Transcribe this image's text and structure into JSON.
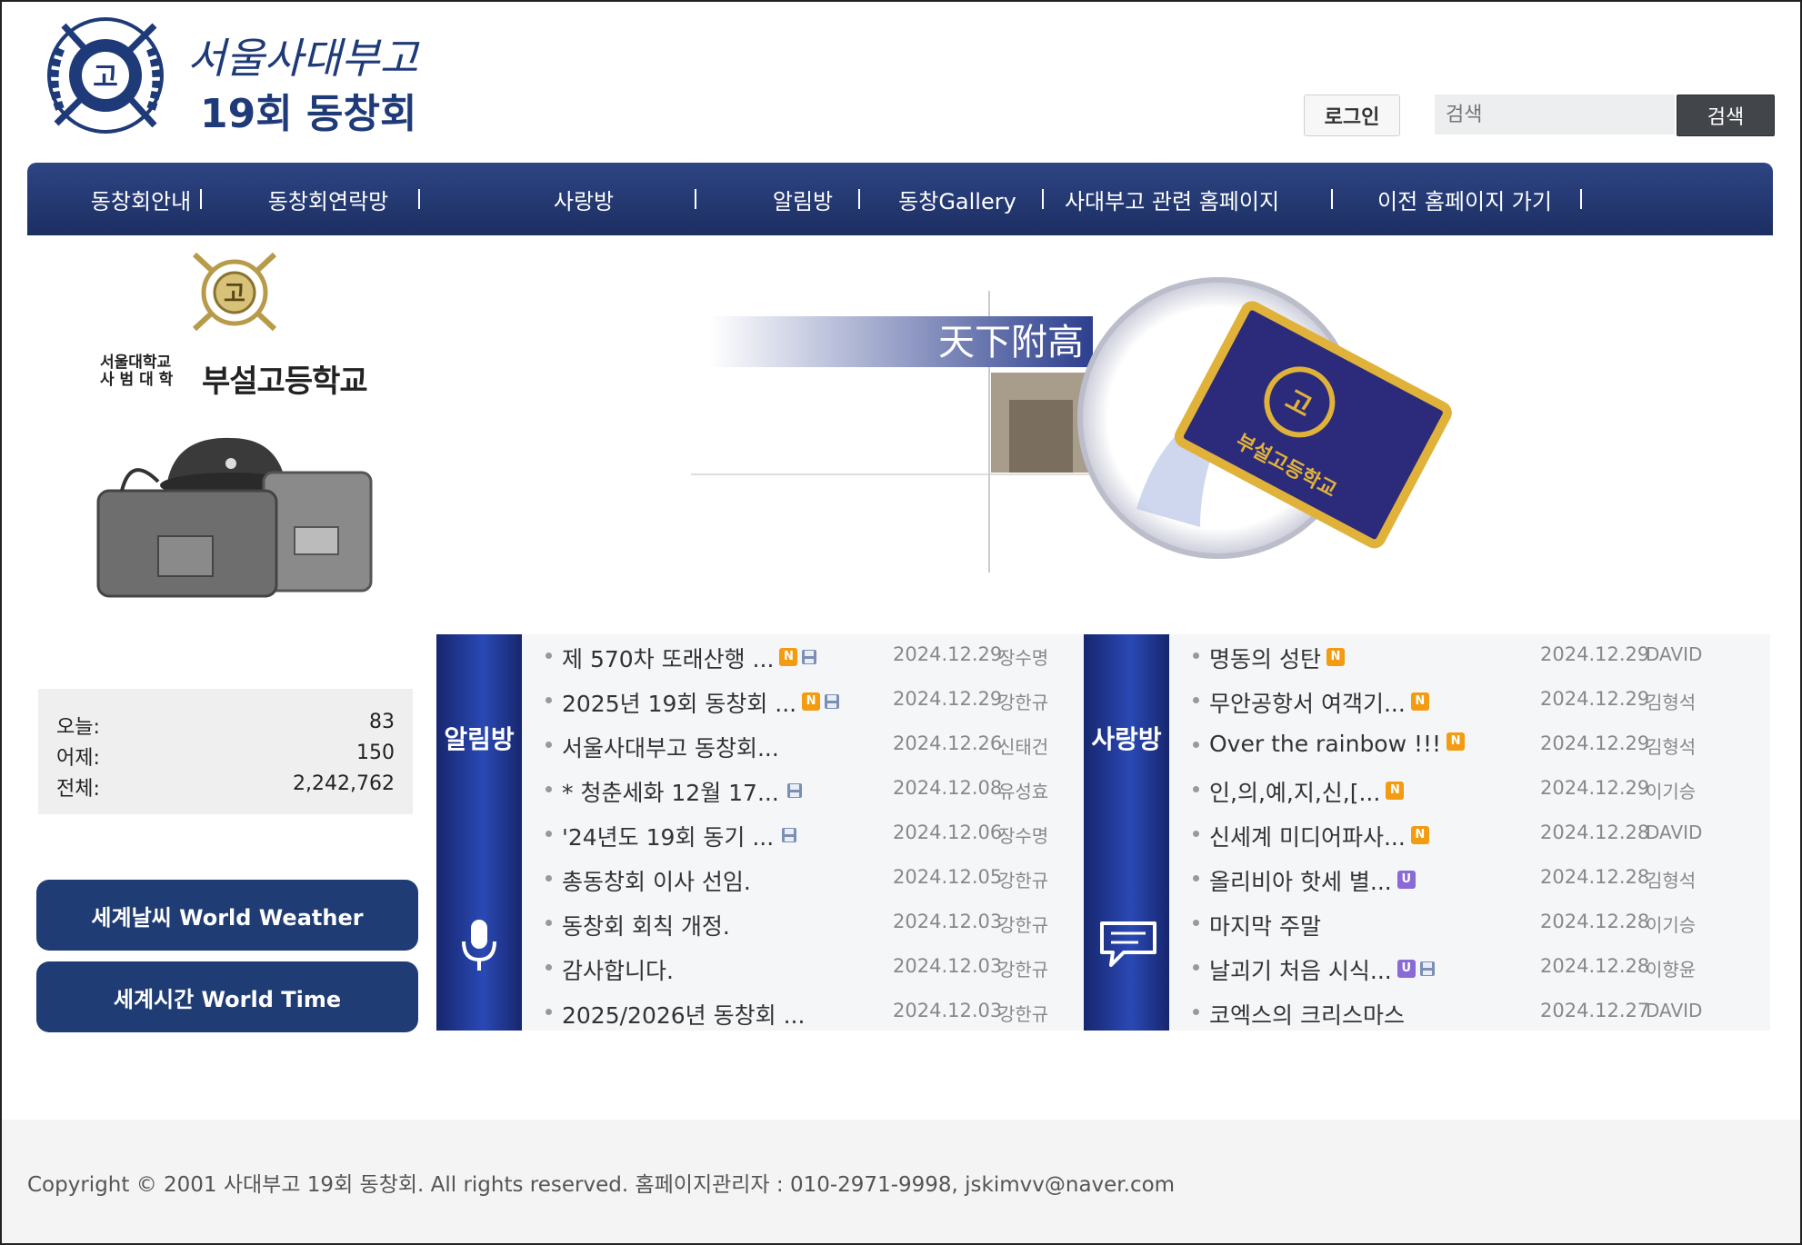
{
  "header": {
    "logo_line1": "서울사대부고",
    "logo_line2": "19회 동창회",
    "logo_emblem_char": "고",
    "login_label": "로그인",
    "search_placeholder": "검색",
    "search_button": "검색"
  },
  "nav": {
    "items": [
      {
        "label": "동창회안내"
      },
      {
        "label": "동창회연락망"
      },
      {
        "label": "사랑방"
      },
      {
        "label": "알림방"
      },
      {
        "label": "동창Gallery"
      },
      {
        "label": "사대부고 관련 홈페이지"
      },
      {
        "label": "이전 홈페이지 가기"
      }
    ]
  },
  "school": {
    "name_small_line1": "서울대학교",
    "name_small_line2": "사 범 대 학",
    "name_big": "부설고등학교",
    "emblem_char": "고"
  },
  "banner": {
    "motto": "天下附高",
    "flag_char": "고",
    "flag_text": "부설고등학교"
  },
  "stats": {
    "today_label": "오늘:",
    "today_value": "83",
    "yesterday_label": "어제:",
    "yesterday_value": "150",
    "total_label": "전체:",
    "total_value": "2,242,762"
  },
  "buttons": {
    "weather": "세계날씨 World Weather",
    "time": "세계시간 World Time"
  },
  "notice_board": {
    "title": "알림방",
    "icon": "microphone-icon",
    "posts": [
      {
        "title": "제 570차 또래산행 ...",
        "new": true,
        "file": true,
        "date": "2024.12.29",
        "author": "장수명"
      },
      {
        "title": "2025년 19회 동창회 ...",
        "new": true,
        "file": true,
        "date": "2024.12.29",
        "author": "강한규"
      },
      {
        "title": "서울사대부고 동창회...",
        "new": false,
        "file": false,
        "date": "2024.12.26",
        "author": "신태건"
      },
      {
        "title": "* 청춘세화 12월 17...",
        "new": false,
        "file": true,
        "date": "2024.12.08",
        "author": "유성효"
      },
      {
        "title": "'24년도 19회 동기 ...",
        "new": false,
        "file": true,
        "date": "2024.12.06",
        "author": "장수명"
      },
      {
        "title": "총동창회 이사 선임.",
        "new": false,
        "file": false,
        "date": "2024.12.05",
        "author": "강한규"
      },
      {
        "title": "동창회 회칙 개정.",
        "new": false,
        "file": false,
        "date": "2024.12.03",
        "author": "강한규"
      },
      {
        "title": "감사합니다.",
        "new": false,
        "file": false,
        "date": "2024.12.03",
        "author": "강한규"
      },
      {
        "title": "2025/2026년 동창회 ...",
        "new": false,
        "file": false,
        "date": "2024.12.03",
        "author": "강한규"
      }
    ]
  },
  "lounge_board": {
    "title": "사랑방",
    "icon": "chat-bubble-icon",
    "posts": [
      {
        "title": "명동의 성탄",
        "badge": "N",
        "file": false,
        "date": "2024.12.29",
        "author": "DAVID"
      },
      {
        "title": "무안공항서 여객기...",
        "badge": "N",
        "file": false,
        "date": "2024.12.29",
        "author": "김형석"
      },
      {
        "title": "Over the rainbow !!!",
        "badge": "N",
        "file": false,
        "date": "2024.12.29",
        "author": "김형석"
      },
      {
        "title": "인,의,예,지,신,[...",
        "badge": "N",
        "file": false,
        "date": "2024.12.29",
        "author": "이기승"
      },
      {
        "title": "신세계 미디어파사...",
        "badge": "N",
        "file": false,
        "date": "2024.12.28",
        "author": "DAVID"
      },
      {
        "title": "올리비아 핫세 별...",
        "badge": "U",
        "file": false,
        "date": "2024.12.28",
        "author": "김형석"
      },
      {
        "title": "마지막 주말",
        "badge": "",
        "file": false,
        "date": "2024.12.28",
        "author": "이기승"
      },
      {
        "title": "날괴기 처음 시식...",
        "badge": "U",
        "file": true,
        "date": "2024.12.28",
        "author": "이향윤"
      },
      {
        "title": "코엑스의 크리스마스",
        "badge": "",
        "file": false,
        "date": "2024.12.27",
        "author": "DAVID"
      }
    ]
  },
  "footer": {
    "text": "Copyright © 2001 사대부고 19회 동창회. All rights reserved.  홈페이지관리자 : 010-2971-9998, jskimvv@naver.com"
  },
  "colors": {
    "nav_bg": "#24397a",
    "button_bg": "#1f3c74",
    "badge_new": "#f39c12",
    "badge_updated": "#8a6ad6"
  }
}
